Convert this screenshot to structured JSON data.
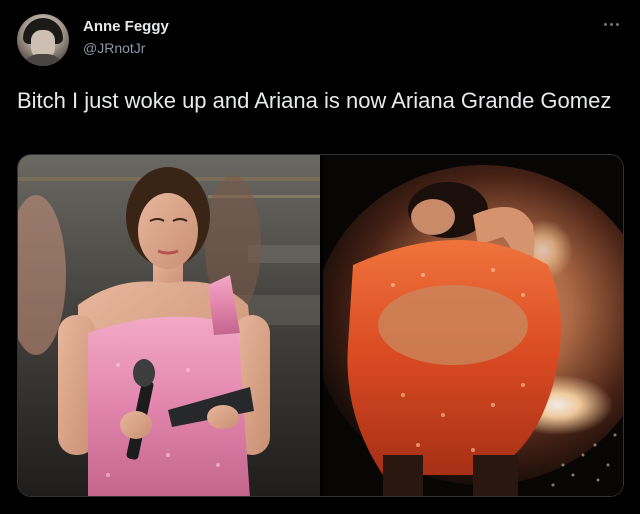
{
  "author": {
    "display_name": "Anne Feggy",
    "handle": "@JRnotJr",
    "avatar_icon": "avatar-photo"
  },
  "tweet": {
    "text": "Bitch I just woke up and Ariana is now Ariana Grande Gomez"
  },
  "menu": {
    "more_icon": "more-horizontal-icon"
  },
  "media": {
    "images": [
      {
        "name": "photo-left"
      },
      {
        "name": "photo-right"
      }
    ]
  },
  "colors": {
    "background": "#000000",
    "primary_text": "#e7e9ea",
    "secondary_text": "#8b98a5",
    "pink_dress": "#e78bb0",
    "orange_dress": "#e2552a"
  }
}
